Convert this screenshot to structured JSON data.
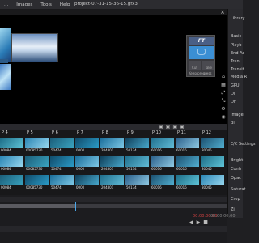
{
  "menu": {
    "items": [
      "...",
      "Images",
      "Tools",
      "Help"
    ],
    "title": "project-07-31-15-36-15.gfx3"
  },
  "window": {
    "close": "×"
  },
  "logo_window": {
    "logo_text": "FT",
    "tab1": "Cut",
    "tab2": "Take",
    "keep_label": "Keep progress"
  },
  "right_panel": {
    "title": "Library",
    "labels": [
      "Basic",
      "Playb",
      "End Ac",
      "Tran",
      "Transit",
      "Media R",
      "GPU",
      "Di",
      "Dr",
      "Image",
      "Bl"
    ],
    "lower_labels": [
      "E/C Settings",
      "Bright",
      "Contr",
      "Opac",
      "Saturat",
      "Crop",
      "Zi"
    ]
  },
  "grid": {
    "headers": [
      "P 4",
      "P 5",
      "P 6",
      "P 7",
      "P 8",
      "P 9",
      "P 10",
      "P 11",
      "P 12"
    ],
    "labels_row1": [
      "00084",
      "00085730",
      "50474",
      "0000",
      "204801",
      "50174",
      "60016",
      "60016",
      "80045"
    ],
    "labels_row2": [
      "00084",
      "00085730",
      "50474",
      "0000",
      "204801",
      "50174",
      "60016",
      "60016",
      "80045"
    ],
    "labels_row3": [
      "00084",
      "00085730",
      "50474",
      "0000",
      "204801",
      "50174",
      "60016",
      "60016",
      "80045"
    ]
  },
  "timeline": {
    "timecode_current": "00:00:00:00",
    "timecode_total": "00:00:00:00",
    "progress": 0.33
  }
}
